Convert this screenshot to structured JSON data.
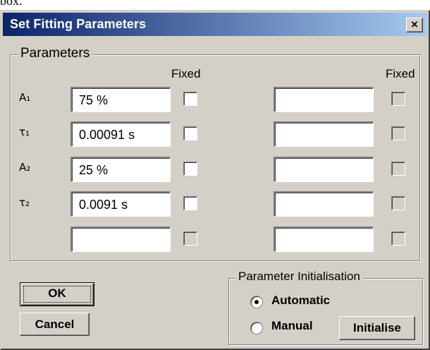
{
  "page_caption": "box.",
  "window": {
    "title": "Set Fitting Parameters",
    "close_label": "×"
  },
  "parameters_group": {
    "label": "Parameters",
    "fixed_header_left": "Fixed",
    "fixed_header_right": "Fixed",
    "rows": [
      {
        "label": "A₁",
        "value": "75 %",
        "right_value": ""
      },
      {
        "label": "τ₁",
        "value": "0.00091 s",
        "right_value": ""
      },
      {
        "label": "A₂",
        "value": "25 %",
        "right_value": ""
      },
      {
        "label": "τ₂",
        "value": "0.0091 s",
        "right_value": ""
      },
      {
        "label": "",
        "value": "",
        "right_value": ""
      }
    ]
  },
  "buttons": {
    "ok": "OK",
    "cancel": "Cancel",
    "initialise": "Initialise"
  },
  "initialisation_group": {
    "label": "Parameter Initialisation",
    "options": [
      {
        "label": "Automatic",
        "selected": true
      },
      {
        "label": "Manual",
        "selected": false
      }
    ]
  },
  "colors": {
    "face": "#d4d0c8",
    "title_start": "#0a246a",
    "title_end": "#a6caf0"
  }
}
